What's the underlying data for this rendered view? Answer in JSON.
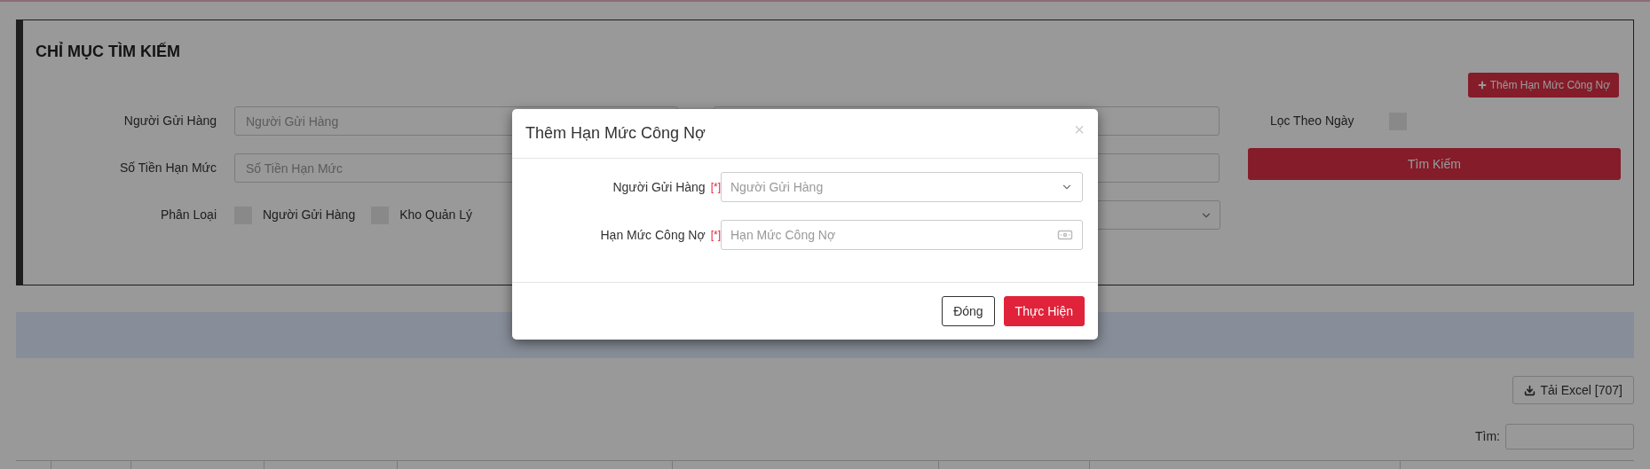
{
  "search_panel": {
    "title": "CHỈ MỤC TÌM KIẾM",
    "add_button": "Thêm Hạn Mức Công Nợ",
    "fields": [
      {
        "label": "Người Gửi Hàng",
        "placeholder": "Người Gửi Hàng"
      },
      {
        "label": "Số Tiền Hạn Mức",
        "placeholder": "Số Tiền Hạn Mức"
      }
    ],
    "classification": {
      "label": "Phân Loại",
      "options": [
        {
          "label": "Người Gửi Hàng",
          "checked": false
        },
        {
          "label": "Kho Quản Lý",
          "checked": false
        }
      ]
    },
    "date_filter": {
      "label": "Lọc Theo Ngày",
      "checked": false
    },
    "search_button": "Tìm Kiếm"
  },
  "results": {
    "excel_button": "Tải Excel [707]",
    "search_label": "Tìm:"
  },
  "modal": {
    "title": "Thêm Hạn Mức Công Nợ",
    "close": "×",
    "fields": [
      {
        "label": "Người Gửi Hàng",
        "required_mark": "[*]",
        "placeholder": "Người Gửi Hàng",
        "kind": "select"
      },
      {
        "label": "Hạn Mức Công Nợ",
        "required_mark": "[*]",
        "placeholder": "Hạn Mức Công Nợ",
        "kind": "money"
      }
    ],
    "buttons": [
      {
        "label": "Đóng",
        "kind": "secondary"
      },
      {
        "label": "Thực Hiện",
        "kind": "primary"
      }
    ]
  }
}
